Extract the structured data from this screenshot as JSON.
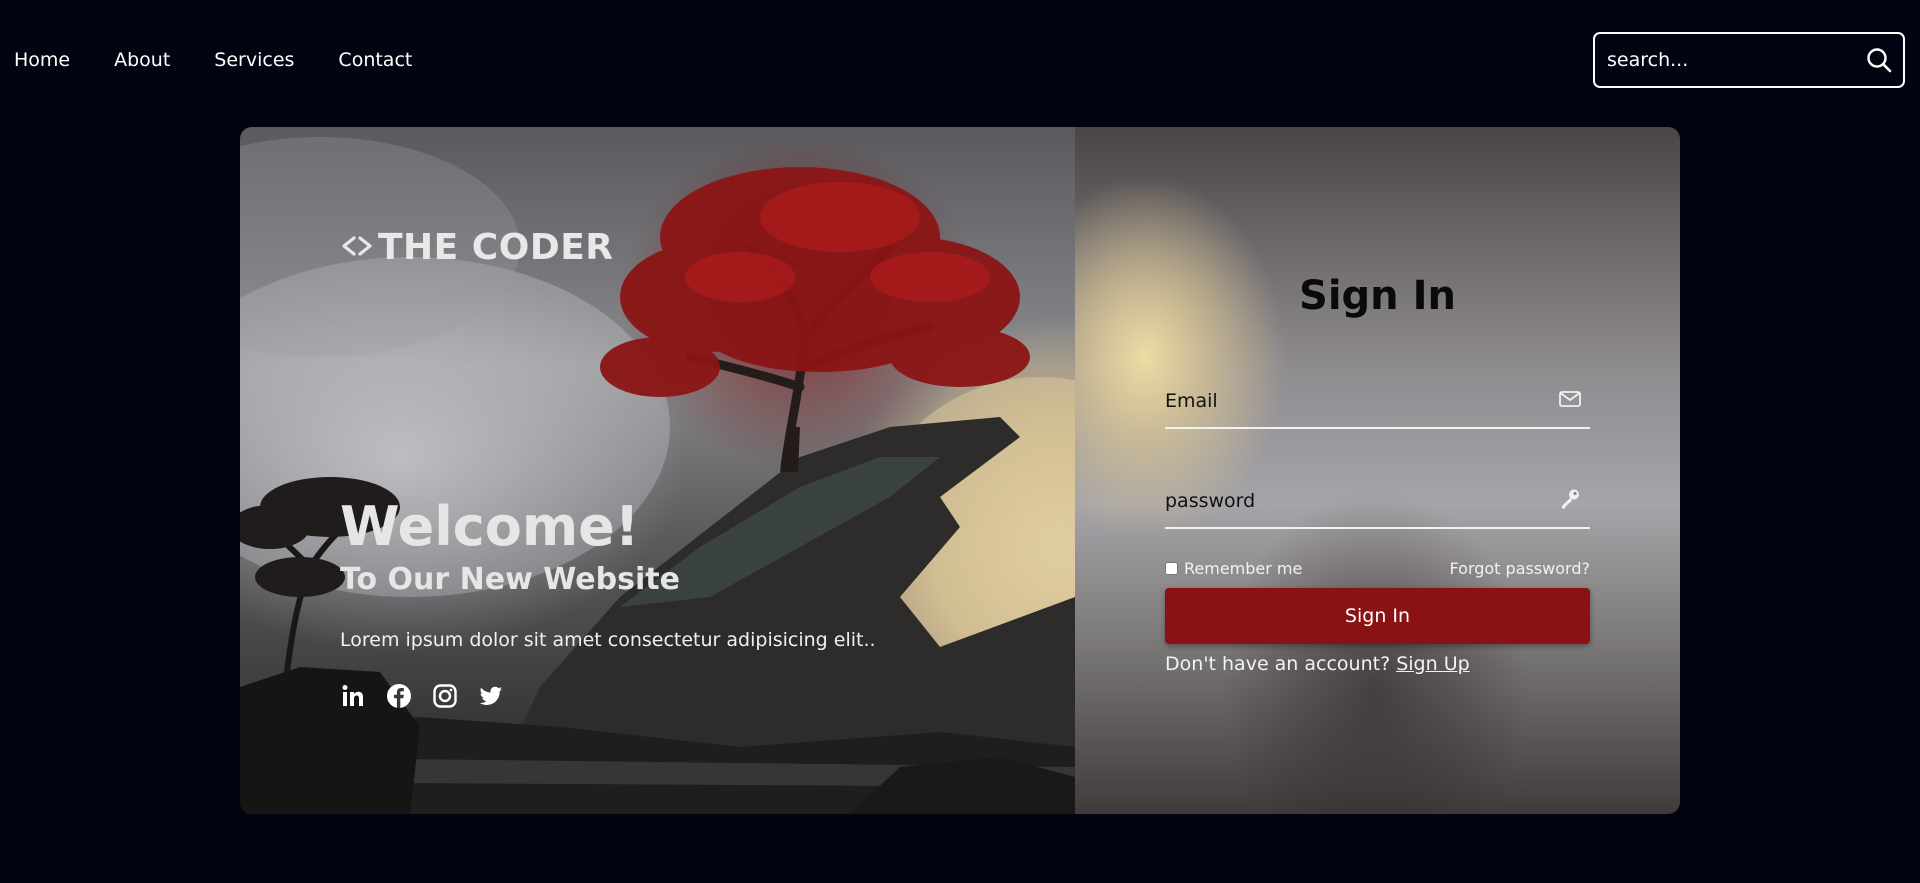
{
  "nav": {
    "links": [
      "Home",
      "About",
      "Services",
      "Contact"
    ]
  },
  "search": {
    "placeholder": "search...",
    "icon": "search-icon"
  },
  "hero": {
    "brand_symbol": "<>",
    "brand_name": "THE CODER",
    "welcome": "Welcome!",
    "subtitle": "To Our New Website",
    "description": "Lorem ipsum dolor sit amet consectetur adipisicing elit..",
    "social_icons": [
      "linkedin-icon",
      "facebook-icon",
      "instagram-icon",
      "twitter-icon"
    ]
  },
  "login": {
    "title": "Sign In",
    "email_placeholder": "Email",
    "password_placeholder": "password",
    "email_icon": "mail-icon",
    "password_icon": "key-icon",
    "remember_label": "Remember me",
    "forgot_label": "Forgot password?",
    "submit_label": "Sign In",
    "signup_prompt": "Don't have an account?",
    "signup_link": "Sign Up"
  },
  "colors": {
    "page_background": "#030412",
    "accent_button": "#8a1212",
    "tree_foliage": "#8b1515",
    "title_text": "#0a0a0a"
  }
}
